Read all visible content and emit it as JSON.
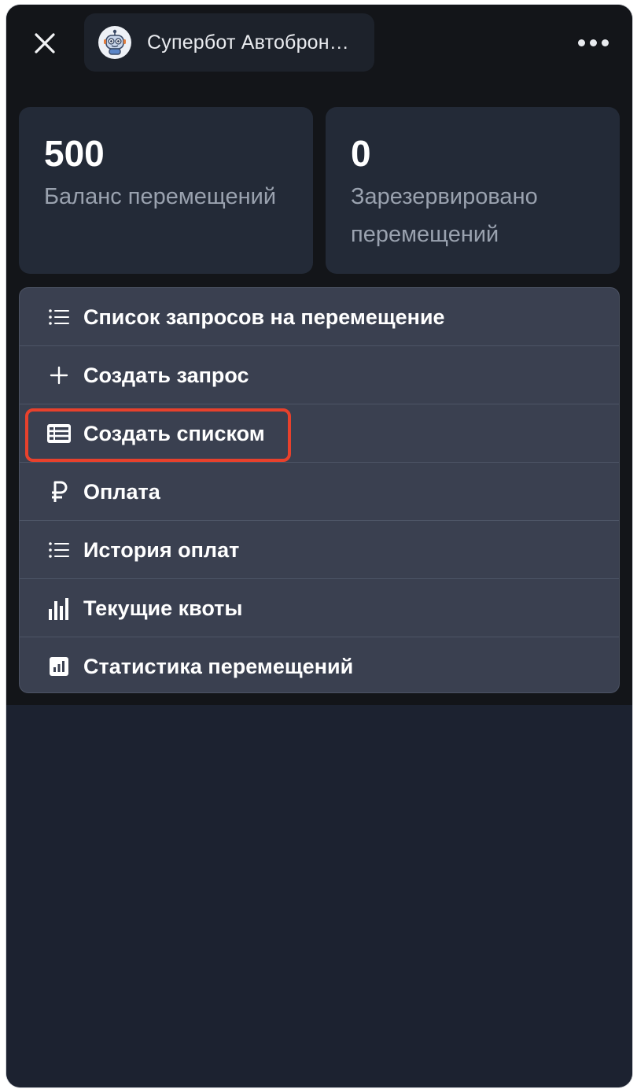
{
  "header": {
    "title": "Супербот Автоброн…",
    "close_icon": "close-icon",
    "more_icon": "more-dots-icon"
  },
  "stats": [
    {
      "value": "500",
      "label": "Баланс перемещений"
    },
    {
      "value": "0",
      "label": "Зарезервировано перемещений"
    }
  ],
  "menu": {
    "items": [
      {
        "label": "Список запросов на перемещение",
        "icon": "list-icon"
      },
      {
        "label": "Создать запрос",
        "icon": "plus-icon"
      },
      {
        "label": "Создать списком",
        "icon": "table-list-icon",
        "highlighted": true
      },
      {
        "label": "Оплата",
        "icon": "ruble-icon"
      },
      {
        "label": "История оплат",
        "icon": "list-icon"
      },
      {
        "label": "Текущие квоты",
        "icon": "bar-chart-icon"
      },
      {
        "label": "Статистика перемещений",
        "icon": "chart-square-icon"
      }
    ]
  },
  "colors": {
    "background": "#131519",
    "card": "#232a37",
    "menu": "#3a4050",
    "highlight": "#e8412c"
  }
}
